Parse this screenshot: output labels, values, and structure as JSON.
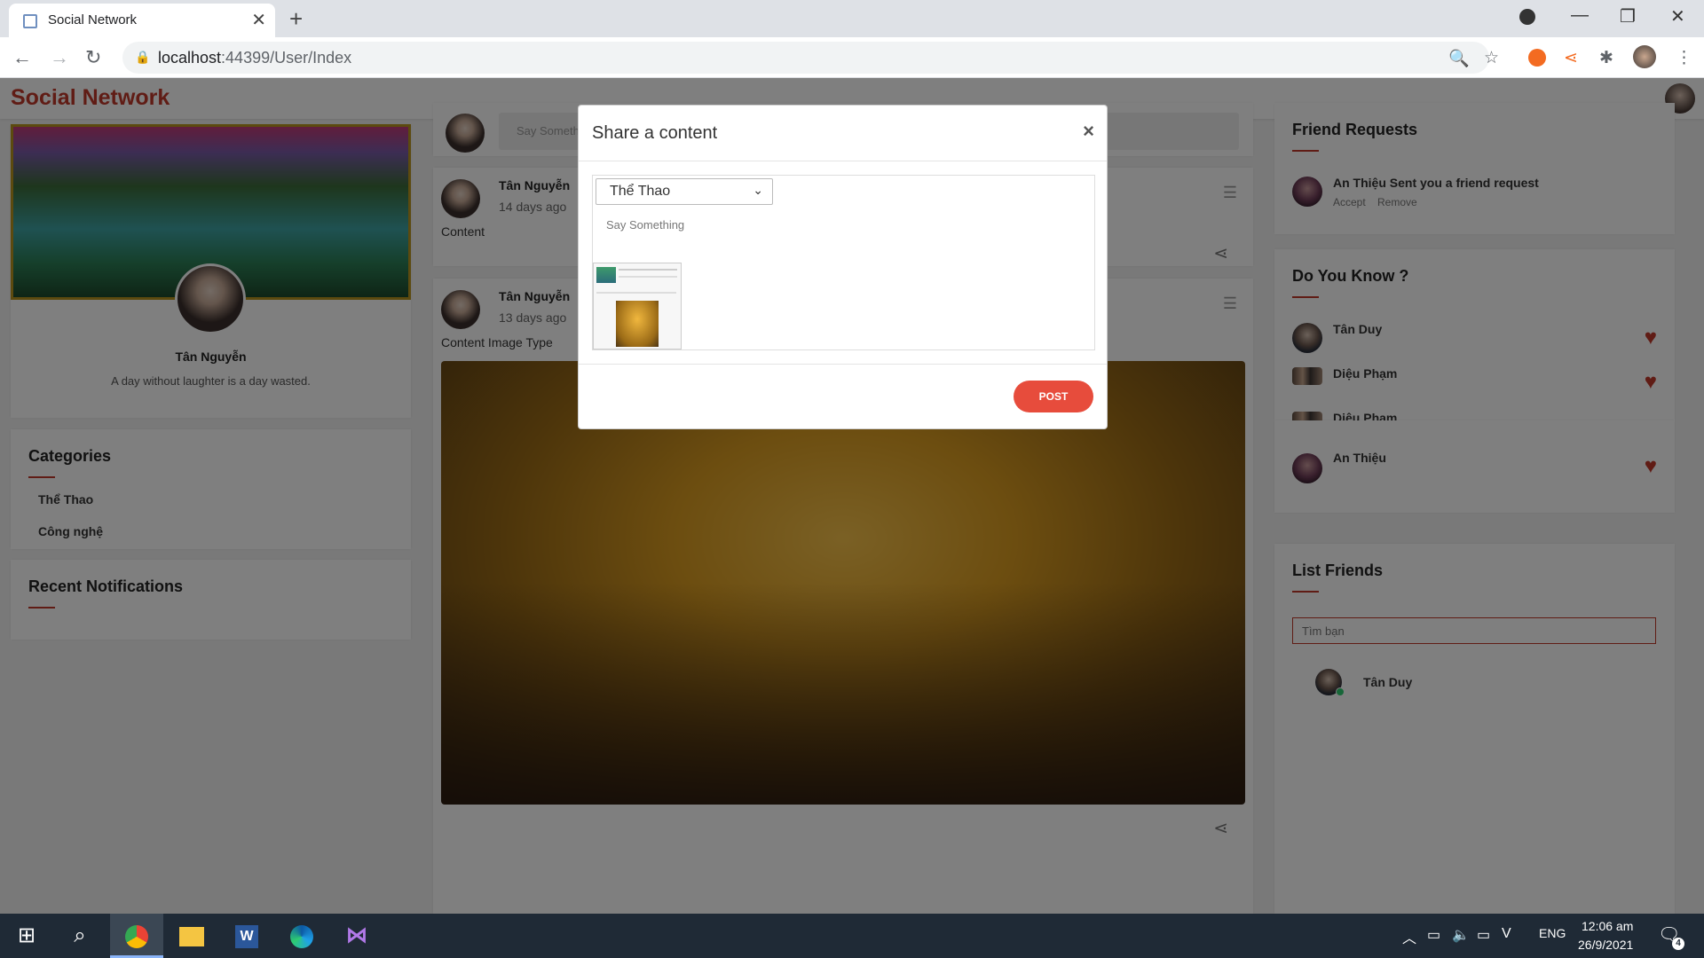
{
  "browser": {
    "tab_title": "Social Network",
    "url_host": "localhost",
    "url_path": ":44399/User/Index"
  },
  "site": {
    "brand": "Social Network"
  },
  "profile": {
    "name": "Tân Nguyễn",
    "bio": "A day without laughter is a day wasted."
  },
  "categories": {
    "title": "Categories",
    "items": [
      "Thể Thao",
      "Công nghệ"
    ]
  },
  "notifications": {
    "title": "Recent Notifications"
  },
  "composer": {
    "placeholder": "Say Something"
  },
  "posts": [
    {
      "author": "Tân Nguyễn",
      "time": "14 days ago",
      "content": "Content"
    },
    {
      "author": "Tân Nguyễn",
      "time": "13 days ago",
      "content": "Content Image Type"
    }
  ],
  "friend_requests": {
    "title": "Friend Requests",
    "items": [
      {
        "name": "An Thiệu",
        "text": "Sent you a friend request",
        "accept": "Accept",
        "remove": "Remove"
      }
    ]
  },
  "do_you_know": {
    "title": "Do You Know ?",
    "items": [
      "Tân Duy",
      "Diệu Phạm",
      "Diệu Phạm",
      "An Thiệu"
    ]
  },
  "list_friends": {
    "title": "List Friends",
    "search_placeholder": "Tìm bạn",
    "items": [
      "Tân Duy"
    ]
  },
  "modal": {
    "title": "Share a content",
    "close": "×",
    "category_selected": "Thể Thao",
    "body_placeholder": "Say Something",
    "post_button": "POST"
  },
  "taskbar": {
    "language": "ENG",
    "time": "12:06 am",
    "date": "26/9/2021",
    "notification_count": "4"
  },
  "colors": {
    "brand": "#c0392b",
    "post_button": "#e74c3c",
    "taskbar": "#1f2a36"
  }
}
